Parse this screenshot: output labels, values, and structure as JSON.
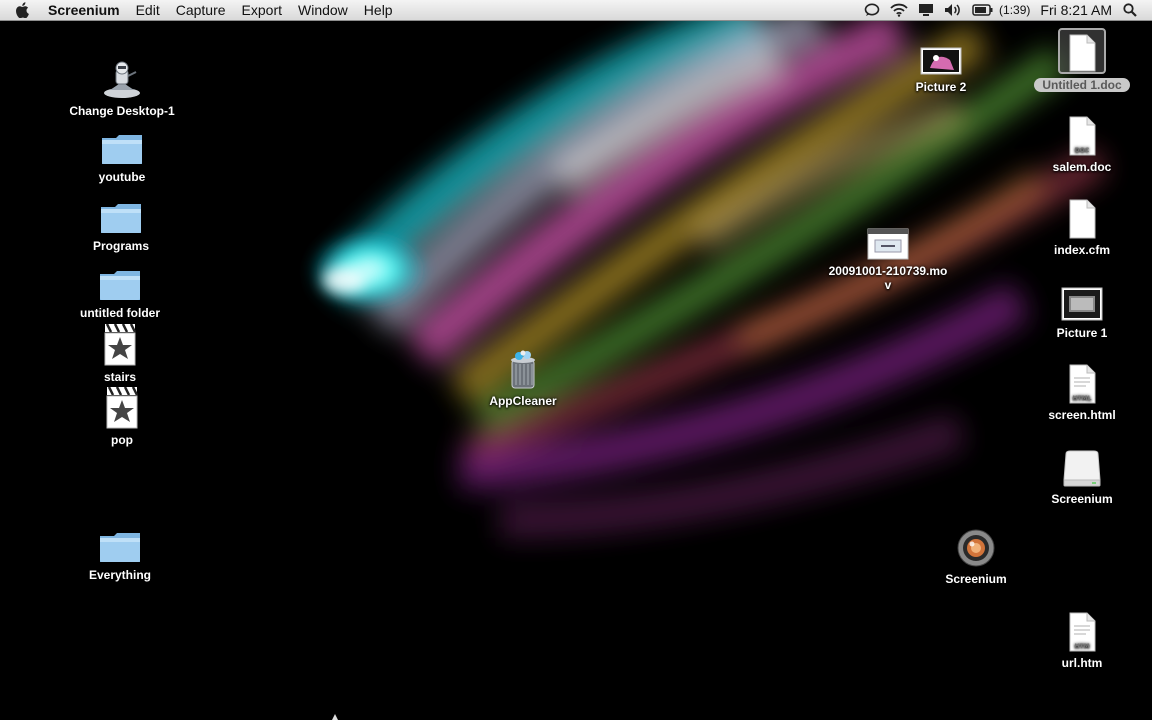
{
  "menubar": {
    "app_name": "Screenium",
    "menus": [
      "Edit",
      "Capture",
      "Export",
      "Window",
      "Help"
    ],
    "battery_time": "(1:39)",
    "clock": "Fri 8:21 AM"
  },
  "desktop": {
    "left_icons": [
      {
        "label": "Change Desktop-1",
        "kind": "app"
      },
      {
        "label": "youtube",
        "kind": "folder"
      },
      {
        "label": "Programs",
        "kind": "folder"
      },
      {
        "label": "untitled folder",
        "kind": "folder"
      },
      {
        "label": "stairs",
        "kind": "movie"
      },
      {
        "label": "pop",
        "kind": "movie"
      },
      {
        "label": "Everything",
        "kind": "folder"
      }
    ],
    "right_icons": [
      {
        "label": "Picture 2",
        "kind": "image"
      },
      {
        "label": "Untitled 1.doc",
        "kind": "document",
        "selected": true
      },
      {
        "label": "salem.doc",
        "kind": "document",
        "badge": "DOC"
      },
      {
        "label": "index.cfm",
        "kind": "document"
      },
      {
        "label": "20091001-210739.mov",
        "kind": "movie-file"
      },
      {
        "label": "Picture 1",
        "kind": "image"
      },
      {
        "label": "screen.html",
        "kind": "document",
        "badge": "HTML"
      },
      {
        "label": "Screenium",
        "kind": "disk"
      },
      {
        "label": "Screenium",
        "kind": "app"
      },
      {
        "label": "url.htm",
        "kind": "document",
        "badge": "HTM"
      }
    ],
    "center_icons": [
      {
        "label": "AppCleaner",
        "kind": "app"
      }
    ]
  },
  "colors": {
    "menubar_top": "#f4f4f4",
    "menubar_bottom": "#d9d9d9",
    "desktop_bg": "#000000",
    "folder_blue": "#8cc3ec",
    "selection_gray": "#c9c9c9"
  }
}
